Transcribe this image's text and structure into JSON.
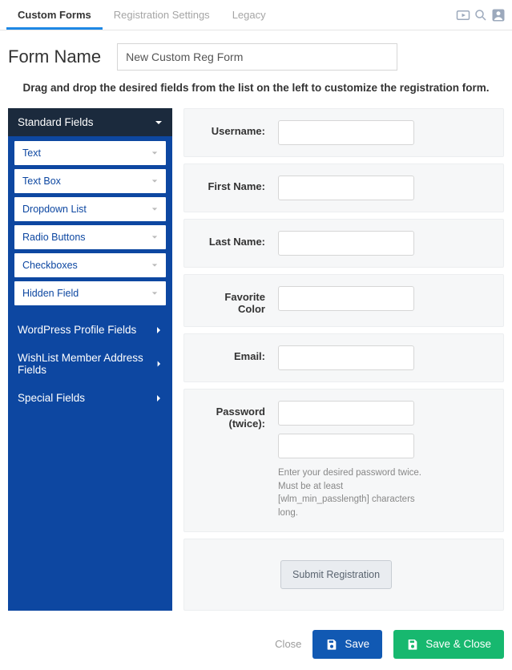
{
  "tabs": {
    "custom_forms": "Custom Forms",
    "registration_settings": "Registration Settings",
    "legacy": "Legacy"
  },
  "form_name_label": "Form Name",
  "form_name_value": "New Custom Reg Form",
  "instructions": "Drag and drop the desired fields from the list on the left to customize the registration form.",
  "sidebar": {
    "standard_fields": {
      "label": "Standard Fields",
      "items": [
        "Text",
        "Text Box",
        "Dropdown List",
        "Radio Buttons",
        "Checkboxes",
        "Hidden Field"
      ]
    },
    "wp_profile_fields": "WordPress Profile Fields",
    "wlm_address_fields": "WishList Member Address Fields",
    "special_fields": "Special Fields"
  },
  "form": {
    "username": "Username:",
    "first_name": "First Name:",
    "last_name": "Last Name:",
    "favorite_color": "Favorite Color",
    "email": "Email:",
    "password": "Password (twice):",
    "password_help": "Enter your desired password twice. Must be at least [wlm_min_passlength] characters long.",
    "submit": "Submit Registration"
  },
  "footer": {
    "close": "Close",
    "save": "Save",
    "save_close": "Save & Close"
  }
}
